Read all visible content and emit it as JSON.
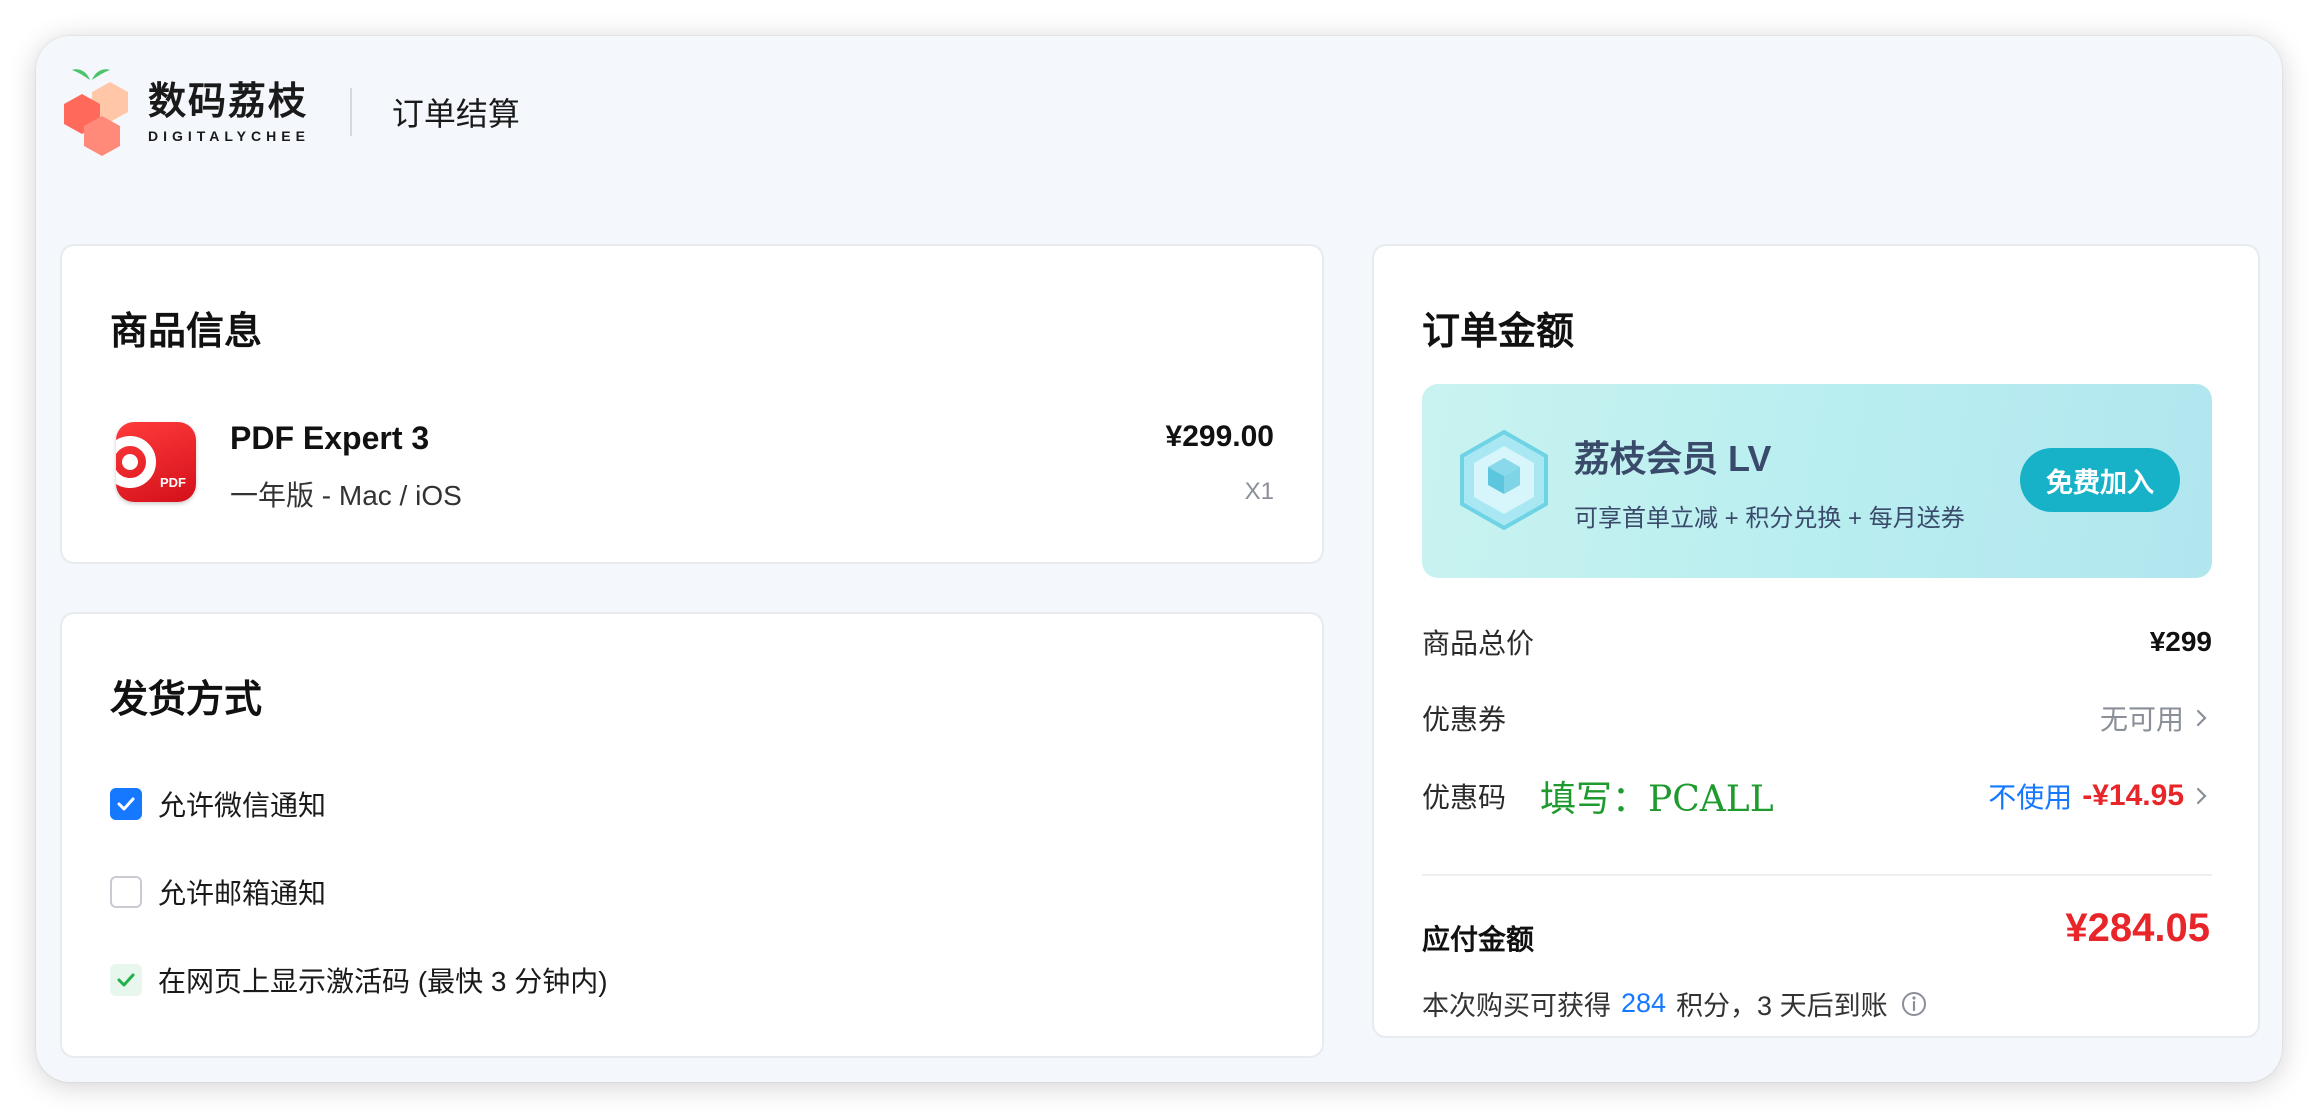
{
  "header": {
    "brand_cn": "数码荔枝",
    "brand_en": "DIGITALYCHEE",
    "page_title": "订单结算"
  },
  "product": {
    "section_title": "商品信息",
    "name": "PDF Expert 3",
    "variant": "一年版 - Mac / iOS",
    "price": "¥299.00",
    "quantity": "X1",
    "icon_text": "PDF"
  },
  "delivery": {
    "section_title": "发货方式",
    "options": [
      {
        "label": "允许微信通知",
        "checked": true
      },
      {
        "label": "允许邮箱通知",
        "checked": false
      },
      {
        "label": "在网页上显示激活码 (最快 3 分钟内)",
        "checked": true
      }
    ]
  },
  "order": {
    "section_title": "订单金额",
    "vip": {
      "title": "荔枝会员 LV",
      "description": "可享首单立减 + 积分兑换 + 每月送券",
      "button": "免费加入"
    },
    "subtotal_label": "商品总价",
    "subtotal_value": "¥299",
    "coupon_label": "优惠券",
    "coupon_value": "无可用",
    "promo_label": "优惠码",
    "promo_note": "填写：PCALL",
    "promo_action": "不使用",
    "promo_discount": "-¥14.95",
    "payable_label": "应付金额",
    "payable_value": "¥284.05",
    "points_prefix": "本次购买可获得",
    "points_value": "284",
    "points_suffix": "积分，3 天后到账"
  },
  "colors": {
    "accent_blue": "#1677ff",
    "price_red": "#e8262a",
    "vip_button": "#17b2c8",
    "promo_green": "#1f9a2e"
  }
}
